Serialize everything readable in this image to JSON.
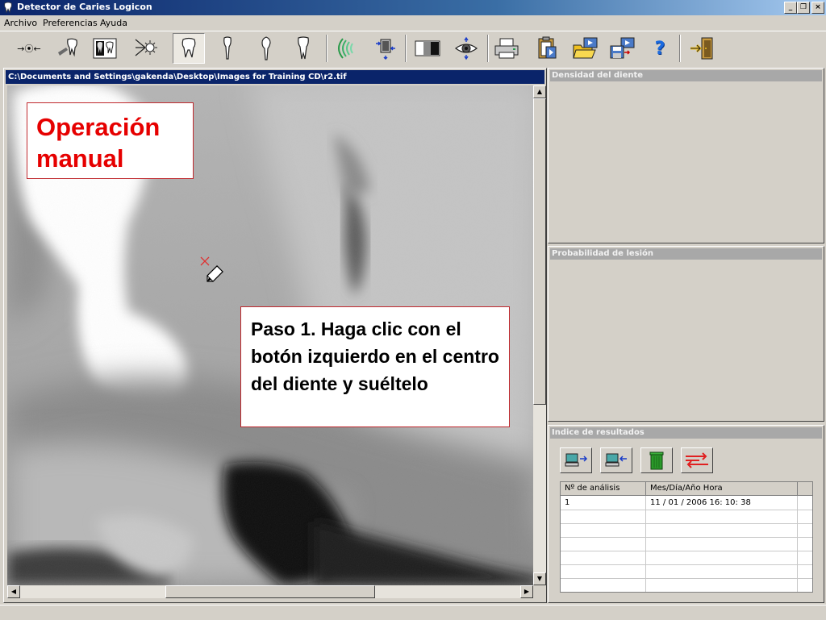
{
  "window": {
    "title": "Detector de Caries Logicon",
    "minimize_glyph": "_",
    "restore_glyph": "❐",
    "close_glyph": "×"
  },
  "menu": [
    "Archivo",
    "Preferencias",
    "Ayuda"
  ],
  "toolbar": {
    "buttons": [
      {
        "icon": "arrow-adjust-icon",
        "glyph": "→⦿←"
      },
      {
        "icon": "tooth-pliers-icon"
      },
      {
        "icon": "tooth-pair-icon"
      },
      {
        "icon": "light-beam-icon"
      },
      {
        "icon": "tooth-molar-icon",
        "pressed": true
      },
      {
        "icon": "tooth-incisor-icon"
      },
      {
        "icon": "tooth-canine-icon"
      },
      {
        "icon": "tooth-premolar-icon"
      },
      {
        "icon": "green-waves-icon"
      },
      {
        "icon": "image-transfer-icon"
      },
      {
        "icon": "contrast-icon"
      },
      {
        "icon": "eye-magnify-icon"
      },
      {
        "icon": "printer-icon"
      },
      {
        "icon": "clipboard-icon"
      },
      {
        "icon": "folder-open-icon"
      },
      {
        "icon": "save-export-icon"
      },
      {
        "icon": "help-icon",
        "glyph": "?"
      },
      {
        "icon": "exit-door-icon"
      }
    ]
  },
  "image_window": {
    "path": "C:\\Documents and Settings\\gakenda\\Desktop\\Images for Training CD\\r2.tif"
  },
  "callouts": {
    "title_line1": "Operación",
    "title_line2": "manual",
    "step_text": "Paso 1. Haga clic con el botón izquierdo en el centro del diente y suéltelo"
  },
  "panels": {
    "density": "Densidad del diente",
    "probability": "Probabilidad de lesión",
    "results": "Indice de resultados"
  },
  "results_buttons": [
    "export-computer-icon",
    "import-computer-icon",
    "trash-icon",
    "transfer-arrows-icon"
  ],
  "results_table": {
    "columns": [
      "Nº de análisis",
      "Mes/Día/Año  Hora"
    ],
    "rows": [
      {
        "id": "1",
        "datetime": "11 / 01 / 2006   16: 10: 38"
      }
    ]
  },
  "colors": {
    "title_bar": "#0a246a",
    "callout_border": "#c0282d",
    "callout_title_text": "#e60000",
    "panel_header": "#a8a8a8"
  }
}
